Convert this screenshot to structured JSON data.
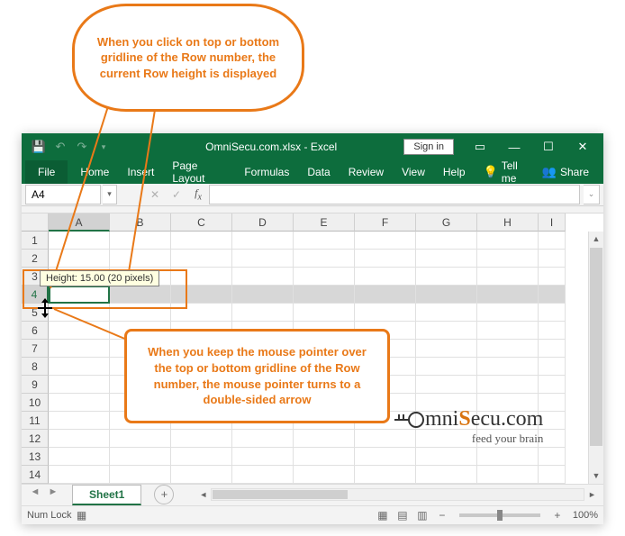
{
  "callouts": {
    "top": "When you click on top or bottom gridline of the Row number, the current Row height is displayed",
    "bottom": "When you keep the mouse pointer over the top or bottom gridline of the Row number, the mouse pointer turns to a double-sided arrow"
  },
  "titlebar": {
    "title": "OmniSecu.com.xlsx - Excel",
    "signin": "Sign in"
  },
  "tabs": {
    "file": "File",
    "home": "Home",
    "insert": "Insert",
    "pagelayout": "Page Layout",
    "formulas": "Formulas",
    "data": "Data",
    "review": "Review",
    "view": "View",
    "help": "Help",
    "tellme": "Tell me",
    "share": "Share"
  },
  "namebox": {
    "value": "A4"
  },
  "columns": [
    "A",
    "B",
    "C",
    "D",
    "E",
    "F",
    "G",
    "H",
    "I"
  ],
  "rows": [
    "1",
    "2",
    "3",
    "4",
    "5",
    "6",
    "7",
    "8",
    "9",
    "10",
    "11",
    "12",
    "13",
    "14"
  ],
  "selected_row_index": 3,
  "tooltip": "Height: 15.00 (20 pixels)",
  "sheet": {
    "name": "Sheet1"
  },
  "statusbar": {
    "numlock": "Num Lock",
    "zoom": "100%",
    "minus": "−",
    "plus": "+"
  },
  "logo": {
    "pre": "mni",
    "mid": "S",
    "post": "ecu.com",
    "tag": "feed your brain"
  }
}
